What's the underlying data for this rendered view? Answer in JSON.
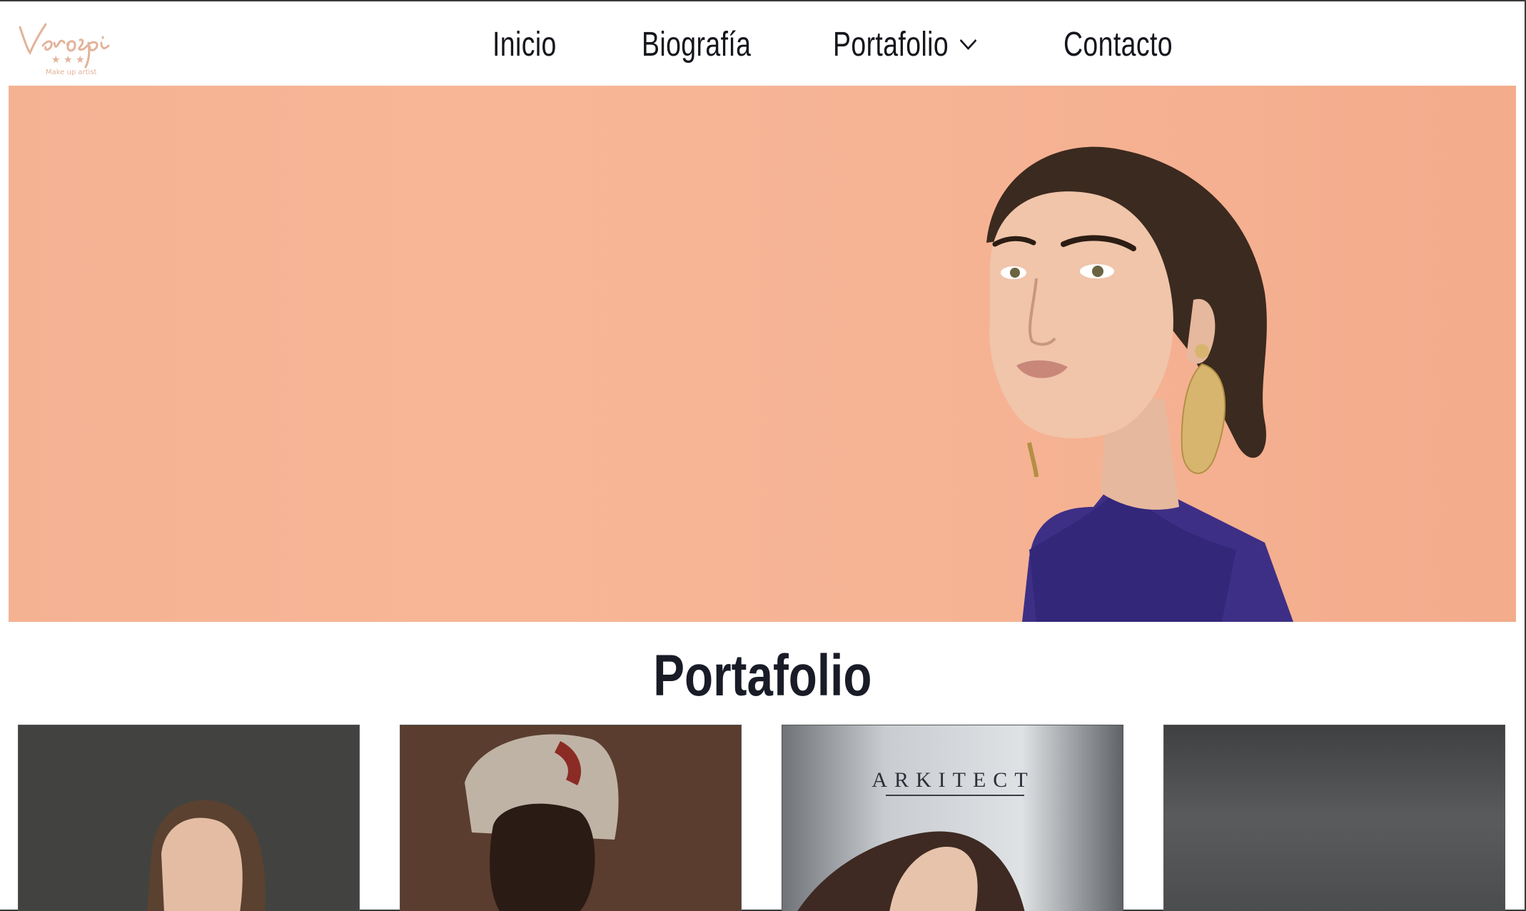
{
  "brand": {
    "logo_text": "Verospi",
    "logo_tagline": "Make up artist",
    "logo_stars": "★ ★ ★",
    "accent_color": "#e8b49a"
  },
  "nav": {
    "items": [
      {
        "label": "Inicio"
      },
      {
        "label": "Biografía"
      },
      {
        "label": "Portafolio",
        "icon": "chevron-down-icon"
      },
      {
        "label": "Contacto"
      }
    ]
  },
  "hero": {
    "background_color": "#f6b495",
    "image_subject": "model portrait"
  },
  "portfolio": {
    "title": "Portafolio",
    "cards": [
      {
        "label": ""
      },
      {
        "label": ""
      },
      {
        "label": "ARKITECT"
      },
      {
        "label": ""
      }
    ]
  }
}
